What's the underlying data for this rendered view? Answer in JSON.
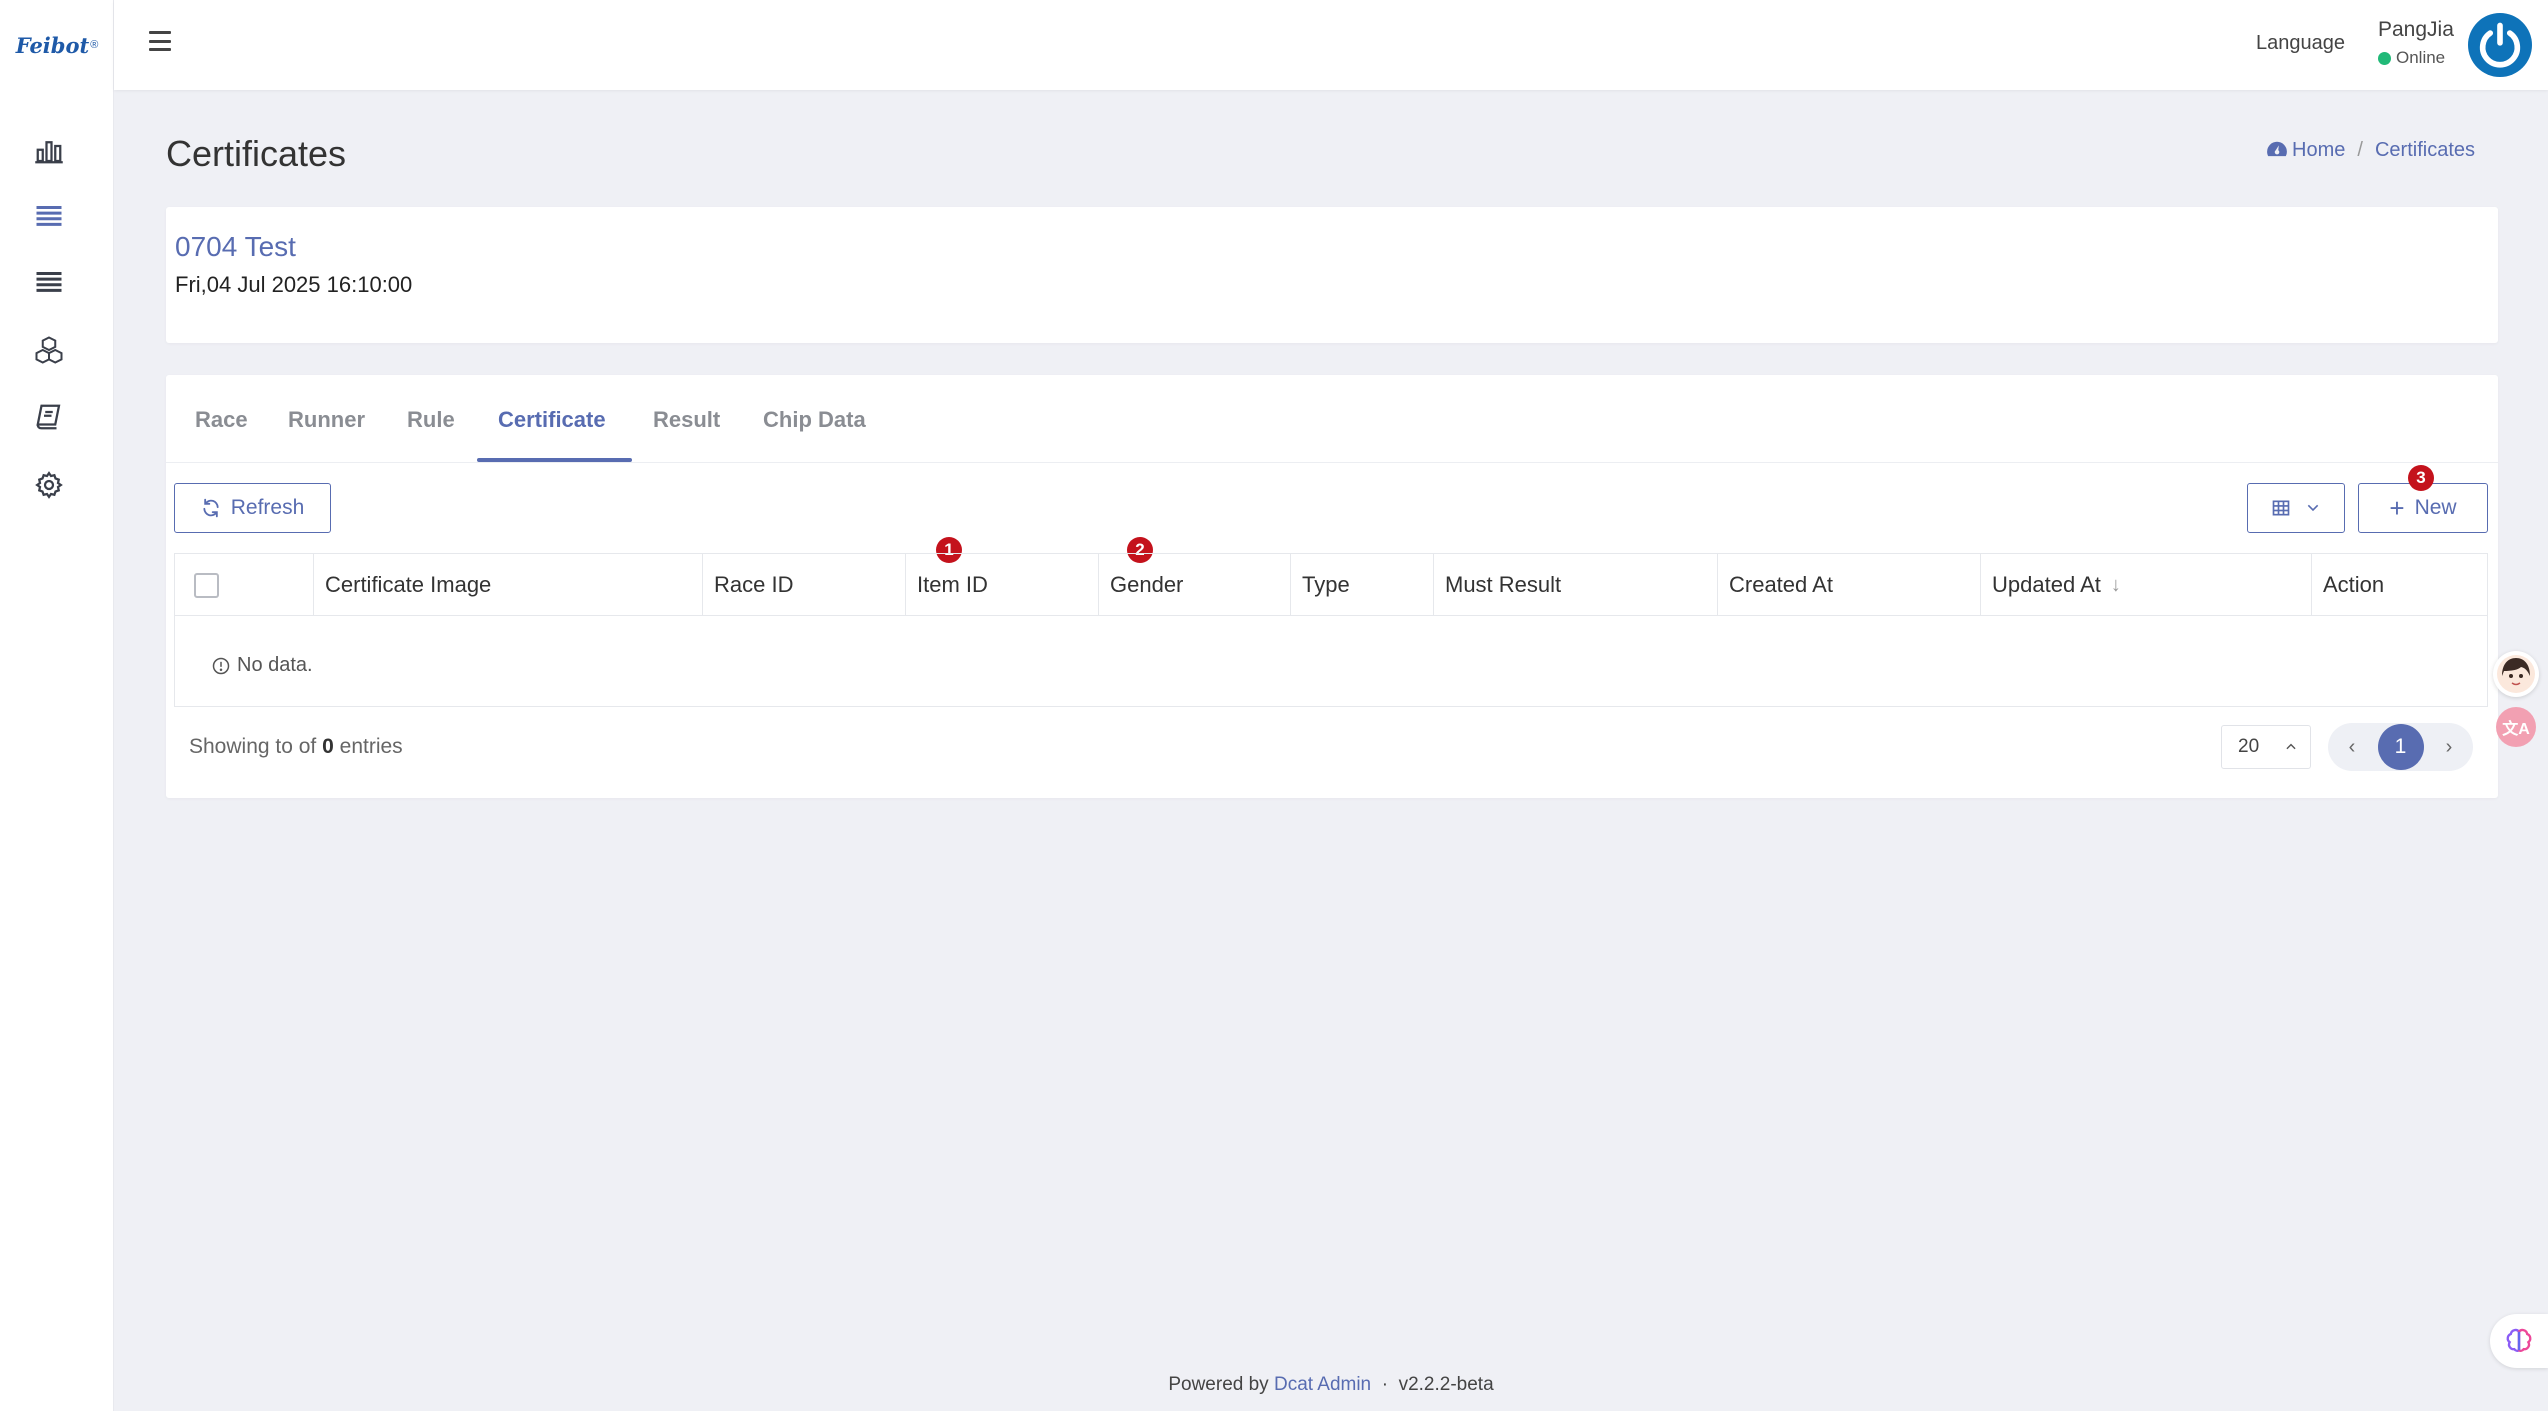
{
  "brand": {
    "logo_text": "Feibot",
    "logo_mark": "®"
  },
  "sidebar": {
    "items": [
      {
        "name": "dashboard",
        "icon": "bar-chart-icon"
      },
      {
        "name": "races",
        "icon": "list-icon",
        "active": true
      },
      {
        "name": "list",
        "icon": "list-icon"
      },
      {
        "name": "modules",
        "icon": "cubes-icon"
      },
      {
        "name": "docs",
        "icon": "book-icon"
      },
      {
        "name": "settings",
        "icon": "gear-icon"
      }
    ]
  },
  "header": {
    "language": "Language",
    "user_name": "PangJia",
    "user_status": "Online",
    "status_color": "#21b978"
  },
  "page": {
    "title": "Certificates",
    "breadcrumb": {
      "home": "Home",
      "separator": "/",
      "current": "Certificates"
    }
  },
  "race": {
    "title": "0704 Test",
    "date": "Fri,04 Jul 2025 16:10:00"
  },
  "tabs": [
    {
      "label": "Race"
    },
    {
      "label": "Runner"
    },
    {
      "label": "Rule"
    },
    {
      "label": "Certificate",
      "active": true
    },
    {
      "label": "Result"
    },
    {
      "label": "Chip Data"
    }
  ],
  "toolbar": {
    "refresh_label": "Refresh",
    "new_label": "New",
    "new_prefix": "+"
  },
  "badges": {
    "b1": "1",
    "b2": "2",
    "b3": "3"
  },
  "table": {
    "columns": [
      "Certificate Image",
      "Race ID",
      "Item ID",
      "Gender",
      "Type",
      "Must Result",
      "Created At",
      "Updated At",
      "Action"
    ],
    "sort_indicator": "↓",
    "empty_text": "No data."
  },
  "pagination": {
    "showing_prefix": "Showing to of",
    "total": "0",
    "showing_suffix": "entries",
    "per_page": "20",
    "current_page": "1",
    "prev": "‹",
    "next": "›",
    "caret": "⌃"
  },
  "footer": {
    "powered_by": "Powered by",
    "link": "Dcat Admin",
    "dot": "·",
    "version": "v2.2.2-beta"
  },
  "colors": {
    "accent": "#586cb1",
    "badge": "#c4121c",
    "avatar": "#0e73b9"
  },
  "floating": {
    "translate_glyph": "文A"
  }
}
